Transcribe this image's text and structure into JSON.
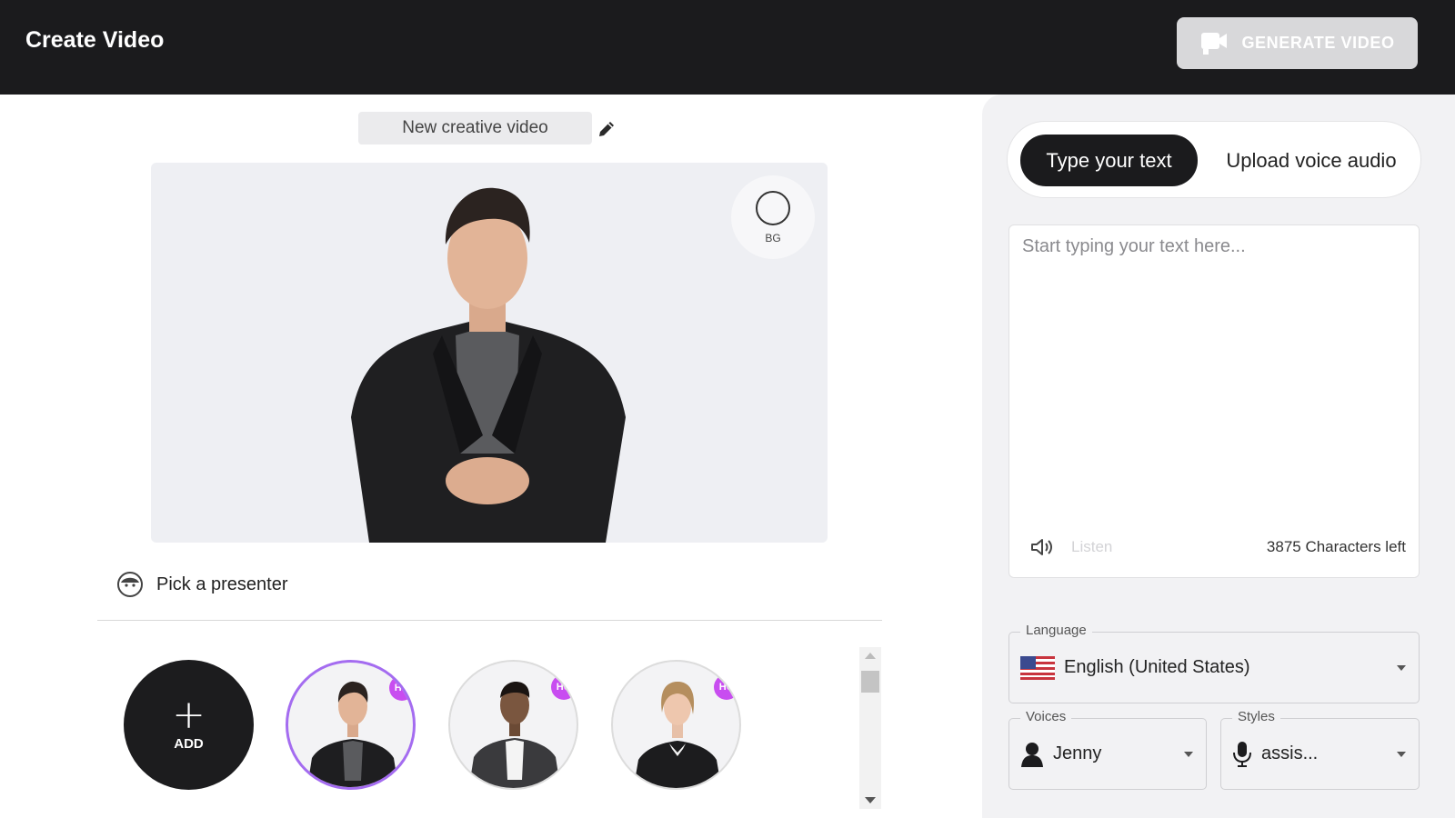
{
  "header": {
    "title": "Create Video",
    "generate_label": "GENERATE VIDEO"
  },
  "editor": {
    "video_title": "New creative video",
    "bg_label": "BG",
    "pick_presenter": "Pick a presenter",
    "add_label": "ADD",
    "presenters": [
      {
        "badge": "HQ",
        "selected": true
      },
      {
        "badge": "HQ",
        "selected": false
      },
      {
        "badge": "HQ",
        "selected": false
      }
    ]
  },
  "script": {
    "tab_type": "Type your text",
    "tab_upload": "Upload voice audio",
    "placeholder": "Start typing your text here...",
    "listen_label": "Listen",
    "chars_left": "3875 Characters left"
  },
  "settings": {
    "language_label": "Language",
    "language_value": "English (United States)",
    "voices_label": "Voices",
    "voice_value": "Jenny",
    "styles_label": "Styles",
    "style_value": "assis..."
  },
  "icons": {
    "generate": "video-camera-icon",
    "edit": "pencil-icon",
    "presenter": "face-icon",
    "speaker": "speaker-icon",
    "flag": "us-flag-icon",
    "voice": "person-icon",
    "style": "microphone-icon"
  },
  "colors": {
    "header_bg": "#1b1b1d",
    "accent_purple": "#c84df0",
    "selected_ring": "#a46cf0"
  }
}
